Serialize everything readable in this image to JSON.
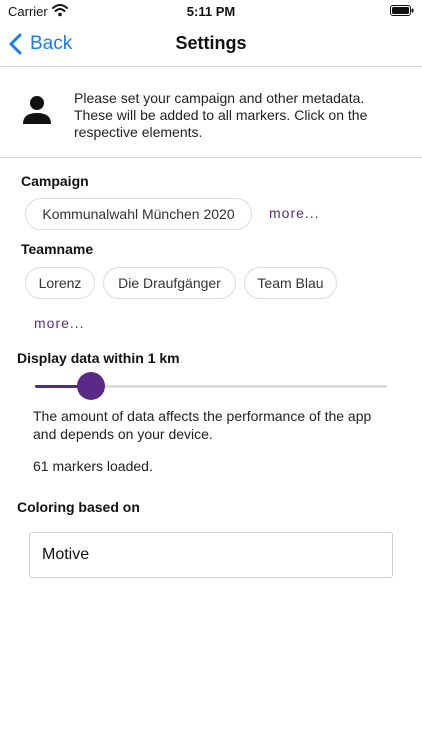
{
  "status_bar": {
    "carrier": "Carrier",
    "time": "5:11 PM"
  },
  "nav": {
    "back_label": "Back",
    "title": "Settings"
  },
  "info": {
    "text": "Please set your campaign and other metadata. These will be added to all markers. Click on the respective elements."
  },
  "campaign": {
    "title": "Campaign",
    "chips": [
      "Kommunalwahl München 2020"
    ],
    "more_label": "more..."
  },
  "teamname": {
    "title": "Teamname",
    "chips": [
      "Lorenz",
      "Die Draufgänger",
      "Team Blau"
    ],
    "more_label": "more..."
  },
  "display": {
    "title": "Display data within 1 km",
    "slider_fraction": 0.16,
    "note": "The amount of data affects the performance of the app and depends on your device.",
    "markers_loaded": "61 markers loaded."
  },
  "coloring": {
    "title": "Coloring based on",
    "selected": "Motive"
  },
  "colors": {
    "accent": "#5b2a86",
    "link": "#1a7cf2"
  },
  "icons": [
    "wifi-icon",
    "battery-icon",
    "chevron-left-icon",
    "person-icon"
  ]
}
